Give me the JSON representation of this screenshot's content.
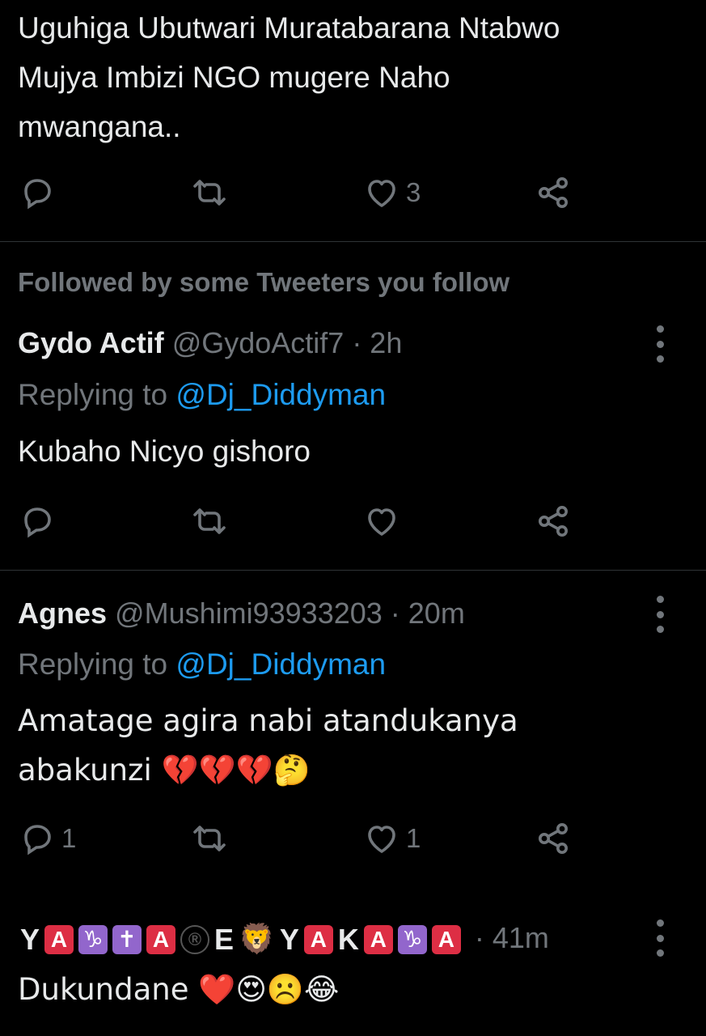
{
  "tweet1": {
    "text": "Uguhiga Ubutwari Muratabarana Ntabwo\nMujya Imbizi NGO mugere Naho\nmwangana..",
    "reply_count": "",
    "retweet_count": "",
    "like_count": "3"
  },
  "social_context": "Followed by some Tweeters you follow",
  "tweet2": {
    "name": "Gydo Actif",
    "handle_time": "@GydoActif7 · 2h",
    "replying_prefix": "Replying to ",
    "replying_to": "@Dj_Diddyman",
    "text": "Kubaho Nicyo gishoro",
    "reply_count": "",
    "retweet_count": "",
    "like_count": ""
  },
  "tweet3": {
    "name": "Agnes",
    "handle_time": "@Mushimi93933203 · 20m",
    "replying_prefix": "Replying to ",
    "replying_to": "@Dj_Diddyman",
    "text": "Amatage agira nabi atandukanya\nabakunzi 💔💔💔🤔",
    "reply_count": "1",
    "retweet_count": "",
    "like_count": "1"
  },
  "tweet4": {
    "name_tiles": [
      "Y",
      "A",
      "♑",
      "✝",
      "A",
      "®",
      "E",
      "🦁",
      "Y",
      "A",
      "K",
      "A",
      "♑",
      "A"
    ],
    "time": "· 41m",
    "text": "Dukundane ❤️😍☹️😂"
  },
  "colors": {
    "background": "#000000",
    "text": "#e7e9ea",
    "muted": "#71767b",
    "link": "#1d9bf0",
    "divider": "#2f3336"
  },
  "icons": [
    "reply-icon",
    "retweet-icon",
    "like-icon",
    "share-icon",
    "more-icon"
  ]
}
